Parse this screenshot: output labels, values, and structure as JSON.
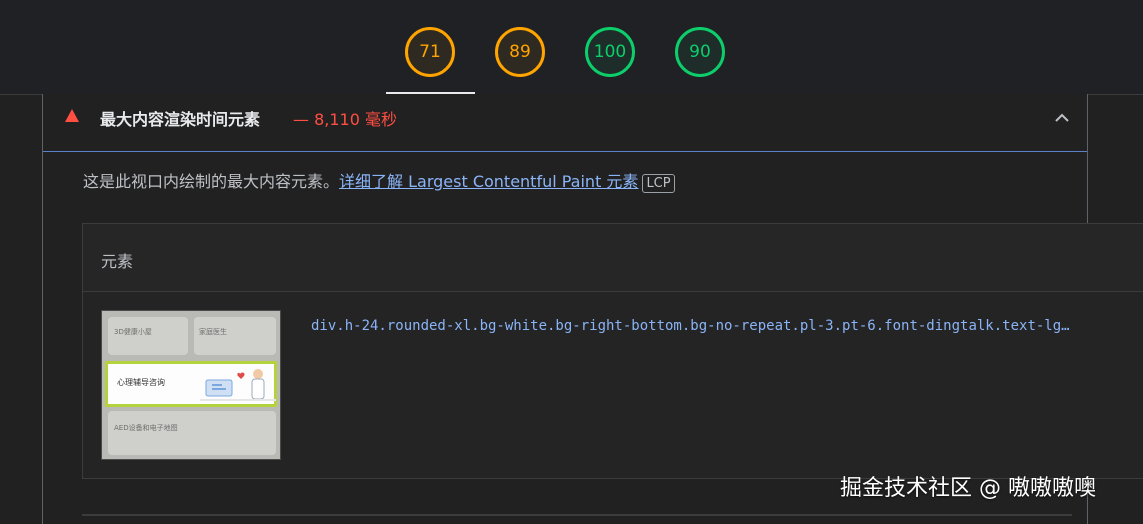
{
  "scores": [
    {
      "value": "71",
      "status": "average",
      "color": "#ffa400"
    },
    {
      "value": "89",
      "status": "average",
      "color": "#ffa400"
    },
    {
      "value": "100",
      "status": "pass",
      "color": "#0cce6b"
    },
    {
      "value": "90",
      "status": "pass",
      "color": "#0cce6b"
    }
  ],
  "audit": {
    "title": "最大内容渲染时间元素",
    "separator": "—",
    "value": "8,110 毫秒",
    "status_color": "#ff4e42",
    "icon": "fail-triangle-icon",
    "expand_icon": "chevron-up-icon"
  },
  "description": {
    "text": "这是此视口内绘制的最大内容元素。",
    "link_text": "详细了解 Largest Contentful Paint 元素",
    "badge": "LCP"
  },
  "table": {
    "header": "元素",
    "rows": [
      {
        "thumbnail": {
          "label_1": "3D健康小屋",
          "label_2": "家庭医生",
          "highlight_label": "心理辅导咨询",
          "label_3": "AED设备和电子地图"
        },
        "node": "div.h-24.rounded-xl.bg-white.bg-right-bottom.bg-no-repeat.pl-3.pt-6.font-dingtalk.text-lg…"
      }
    ]
  },
  "watermark": "掘金技术社区 @ 嗷嗷嗷噢",
  "colors": {
    "background": "#212121",
    "link": "#8ab4f8",
    "accent_border": "#5b82c9"
  }
}
